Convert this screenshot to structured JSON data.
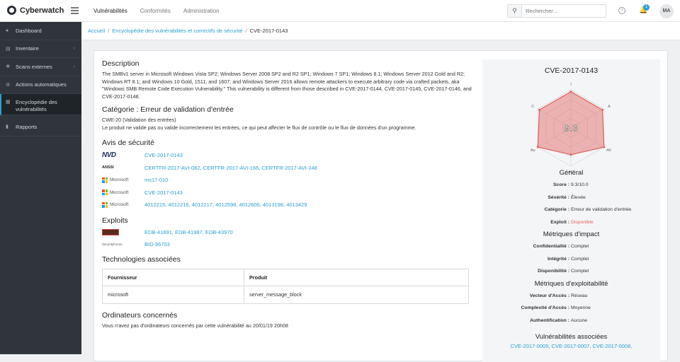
{
  "brand": {
    "name": "Cyberwatch"
  },
  "topnav": {
    "items": [
      "Vulnérabilités",
      "Conformités",
      "Administration"
    ]
  },
  "search": {
    "placeholder": "Rechercher..."
  },
  "notifications": {
    "count": "1"
  },
  "user": {
    "initials": "MA"
  },
  "sidebar": {
    "items": [
      {
        "label": "Dashboard",
        "icon": "dashboard-icon"
      },
      {
        "label": "Inventaire",
        "icon": "inventory-icon"
      },
      {
        "label": "Scans externes",
        "icon": "scan-icon"
      },
      {
        "label": "Actions automatiques",
        "icon": "gear-icon"
      },
      {
        "label": "Encyclopédie des vulnérabilités",
        "icon": "book-icon"
      },
      {
        "label": "Rapports",
        "icon": "chart-icon"
      }
    ]
  },
  "breadcrumb": {
    "home": "Accueil",
    "section": "Encyclopédie des vulnérabilités et correctifs de sécurité",
    "current": "CVE-2017-0143"
  },
  "description": {
    "title": "Description",
    "text": "The SMBv1 server in Microsoft Windows Vista SP2; Windows Server 2008 SP2 and R2 SP1; Windows 7 SP1; Windows 8.1; Windows Server 2012 Gold and R2; Windows RT 8.1; and Windows 10 Gold, 1511, and 1607; and Windows Server 2016 allows remote attackers to execute arbitrary code via crafted packets, aka \"Windows SMB Remote Code Execution Vulnerability.\" This vulnerability is different from those described in CVE-2017-0144, CVE-2017-0145, CVE-2017-0146, and CVE-2017-0148."
  },
  "category": {
    "title": "Catégorie : Erreur de validation d'entrée",
    "cwe": "CWE-20 (Validation des entrées)",
    "text": "Le produit ne valide pas ou valide incorrectement les entrées, ce qui peut affecter le flux de contrôle ou le flux de données d'un programme."
  },
  "advisories": {
    "title": "Avis de sécurité",
    "nvd_logo": "NVD",
    "anssi_logo": "ANSSI",
    "ms_logo": "Microsoft",
    "nvd": "CVE-2017-0143",
    "anssi": "CERTFR-2017-AVI-082, CERTFR-2017-AVI-166, CERTFR-2017-AVI-248",
    "ms1": "ms17-010",
    "ms2": "CVE-2017-0143",
    "ms3": "4012215, 4012216, 4012217, 4012598, 4012606, 4013198, 4013429"
  },
  "exploits": {
    "title": "Exploits",
    "securityfocus_logo": "SecurityFocus",
    "edb": "EDB-41891, EDB-41987, EDB-43970",
    "bid": "BID-96703"
  },
  "technologies": {
    "title": "Technologies associées",
    "headers": [
      "Fournisseur",
      "Produit"
    ],
    "rows": [
      [
        "microsoft",
        "server_message_block"
      ]
    ]
  },
  "computers": {
    "title": "Ordinateurs concernés",
    "text": "Vous n'avez pas d'ordinateurs concernés par cette vulnérabilité au 20/01/19 20h08"
  },
  "panel": {
    "cve": "CVE-2017-0143",
    "radar": {
      "score": "9.3",
      "labels": [
        "I",
        "A",
        "AV",
        "AC",
        "Au",
        "C"
      ],
      "values": [
        0.95,
        0.95,
        1.0,
        0.7,
        1.0,
        0.95
      ]
    },
    "general_title": "Général",
    "general": [
      {
        "k": "Score :",
        "v": "9.3/10.0"
      },
      {
        "k": "Sévérité :",
        "v": "Élevée"
      },
      {
        "k": "Catégorie :",
        "v": "Erreur de validation d'entrée"
      },
      {
        "k": "Exploit :",
        "v": "Disponible"
      }
    ],
    "impact_title": "Métriques d'impact",
    "impact": [
      {
        "k": "Confidentialité :",
        "v": "Complet"
      },
      {
        "k": "Intégrité :",
        "v": "Complet"
      },
      {
        "k": "Disponibilité :",
        "v": "Complet"
      }
    ],
    "exploit_title": "Métriques d'exploitabilité",
    "exploitability": [
      {
        "k": "Vecteur d'Accès :",
        "v": "Réseau"
      },
      {
        "k": "Complexité d'Accès :",
        "v": "Moyenne"
      },
      {
        "k": "Authentification :",
        "v": "Aucune"
      }
    ],
    "related_title": "Vulnérabilités associées",
    "related": "CVE-2017-0005, CVE-2017-0007, CVE-2017-0008,"
  },
  "colors": {
    "accent": "#2a9fd6",
    "sidebar": "#2f353b",
    "radar": "#e0625a"
  }
}
